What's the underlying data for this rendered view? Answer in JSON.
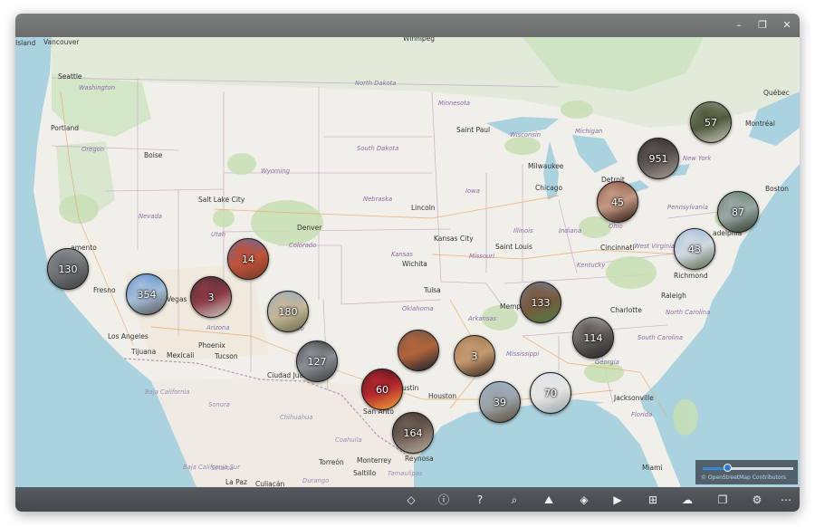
{
  "window": {
    "controls": {
      "minimize": "–",
      "maximize": "❐",
      "close": "✕"
    }
  },
  "map": {
    "labels": [
      {
        "id": "island",
        "text": "Island",
        "kind": "city"
      },
      {
        "id": "vancouver",
        "text": "Vancouver",
        "kind": "city"
      },
      {
        "id": "winnipeg",
        "text": "Winnipeg",
        "kind": "city"
      },
      {
        "id": "seattle",
        "text": "Seattle",
        "kind": "city"
      },
      {
        "id": "washington",
        "text": "Washington",
        "kind": "state"
      },
      {
        "id": "north-dakota",
        "text": "North Dakota",
        "kind": "state"
      },
      {
        "id": "quebec",
        "text": "Québec",
        "kind": "city"
      },
      {
        "id": "minnesota",
        "text": "Minnesota",
        "kind": "state"
      },
      {
        "id": "montreal",
        "text": "Montréal",
        "kind": "city"
      },
      {
        "id": "portland",
        "text": "Portland",
        "kind": "city"
      },
      {
        "id": "saint-paul",
        "text": "Saint Paul",
        "kind": "city"
      },
      {
        "id": "michigan",
        "text": "Michigan",
        "kind": "state"
      },
      {
        "id": "wisconsin",
        "text": "Wisconsin",
        "kind": "state"
      },
      {
        "id": "oregon",
        "text": "Oregon",
        "kind": "state"
      },
      {
        "id": "south-dakota",
        "text": "South Dakota",
        "kind": "state"
      },
      {
        "id": "boise",
        "text": "Boise",
        "kind": "city"
      },
      {
        "id": "new-york",
        "text": "New York",
        "kind": "state"
      },
      {
        "id": "milwaukee",
        "text": "Milwaukee",
        "kind": "city"
      },
      {
        "id": "wyoming",
        "text": "Wyoming",
        "kind": "state"
      },
      {
        "id": "detroit",
        "text": "Detroit",
        "kind": "city"
      },
      {
        "id": "chicago",
        "text": "Chicago",
        "kind": "city"
      },
      {
        "id": "boston",
        "text": "Boston",
        "kind": "city"
      },
      {
        "id": "iowa",
        "text": "Iowa",
        "kind": "state"
      },
      {
        "id": "nebraska",
        "text": "Nebraska",
        "kind": "state"
      },
      {
        "id": "salt-lake-city",
        "text": "Salt Lake City",
        "kind": "city"
      },
      {
        "id": "lincoln",
        "text": "Lincoln",
        "kind": "city"
      },
      {
        "id": "pennsylvania",
        "text": "Pennsylvania",
        "kind": "state"
      },
      {
        "id": "nevada",
        "text": "Nevada",
        "kind": "state"
      },
      {
        "id": "denver",
        "text": "Denver",
        "kind": "city"
      },
      {
        "id": "illinois",
        "text": "Illinois",
        "kind": "state"
      },
      {
        "id": "utah",
        "text": "Utah",
        "kind": "state"
      },
      {
        "id": "indiana",
        "text": "Indiana",
        "kind": "state"
      },
      {
        "id": "ohio",
        "text": "Ohio",
        "kind": "state"
      },
      {
        "id": "kansas-city",
        "text": "Kansas City",
        "kind": "city"
      },
      {
        "id": "colorado",
        "text": "Colorado",
        "kind": "state"
      },
      {
        "id": "philadelphia",
        "text": "adelphia",
        "kind": "city"
      },
      {
        "id": "saint-louis",
        "text": "Saint Louis",
        "kind": "city"
      },
      {
        "id": "cincinnati",
        "text": "Cincinnati",
        "kind": "city"
      },
      {
        "id": "west-virginia",
        "text": "West Virginia",
        "kind": "state"
      },
      {
        "id": "sacramento",
        "text": "amento",
        "kind": "city"
      },
      {
        "id": "kansas",
        "text": "Kansas",
        "kind": "state"
      },
      {
        "id": "missouri",
        "text": "Missouri",
        "kind": "state"
      },
      {
        "id": "wichita",
        "text": "Wichita",
        "kind": "city"
      },
      {
        "id": "kentucky",
        "text": "Kentucky",
        "kind": "state"
      },
      {
        "id": "richmond",
        "text": "Richmond",
        "kind": "city"
      },
      {
        "id": "tulsa",
        "text": "Tulsa",
        "kind": "city"
      },
      {
        "id": "fresno",
        "text": "Fresno",
        "kind": "city"
      },
      {
        "id": "las-vegas",
        "text": "Vegas",
        "kind": "city"
      },
      {
        "id": "raleigh",
        "text": "Raleigh",
        "kind": "city"
      },
      {
        "id": "oklahoma",
        "text": "Oklahoma",
        "kind": "state"
      },
      {
        "id": "memphis",
        "text": "Memph",
        "kind": "city"
      },
      {
        "id": "charlotte",
        "text": "Charlotte",
        "kind": "city"
      },
      {
        "id": "arkansas",
        "text": "Arkansas",
        "kind": "state"
      },
      {
        "id": "arizona",
        "text": "Arizona",
        "kind": "state"
      },
      {
        "id": "north-carolina",
        "text": "North Carolina",
        "kind": "state"
      },
      {
        "id": "new-mexico",
        "text": "xico",
        "kind": "state"
      },
      {
        "id": "los-angeles",
        "text": "Los Angeles",
        "kind": "city"
      },
      {
        "id": "phoenix",
        "text": "Phoenix",
        "kind": "city"
      },
      {
        "id": "south-carolina",
        "text": "South Carolina",
        "kind": "state"
      },
      {
        "id": "tijuana",
        "text": "Tijuana",
        "kind": "city"
      },
      {
        "id": "mexicali",
        "text": "Mexicali",
        "kind": "city"
      },
      {
        "id": "tucson",
        "text": "Tucson",
        "kind": "city"
      },
      {
        "id": "mississippi",
        "text": "Mississippi",
        "kind": "state"
      },
      {
        "id": "georgia",
        "text": "Georgia",
        "kind": "state"
      },
      {
        "id": "ciudad-juarez",
        "text": "Ciudad Jua",
        "kind": "city"
      },
      {
        "id": "baja-california",
        "text": "Baja California",
        "kind": "state-mx"
      },
      {
        "id": "austin",
        "text": "ustin",
        "kind": "city"
      },
      {
        "id": "houston",
        "text": "Houston",
        "kind": "city"
      },
      {
        "id": "jacksonville",
        "text": "Jacksonville",
        "kind": "city"
      },
      {
        "id": "san-antonio",
        "text": "San Anto",
        "kind": "city"
      },
      {
        "id": "sonora",
        "text": "Sonora",
        "kind": "state-mx"
      },
      {
        "id": "chihuahua",
        "text": "Chihuahua",
        "kind": "state-mx"
      },
      {
        "id": "florida",
        "text": "Florida",
        "kind": "state"
      },
      {
        "id": "coahuila",
        "text": "Coahuila",
        "kind": "state-mx"
      },
      {
        "id": "monterrey",
        "text": "Monterrey",
        "kind": "city"
      },
      {
        "id": "torreon",
        "text": "Torreón",
        "kind": "city"
      },
      {
        "id": "reynosa",
        "text": "Reynosa",
        "kind": "city"
      },
      {
        "id": "saltillo",
        "text": "Saltillo",
        "kind": "city"
      },
      {
        "id": "baja-california-sur",
        "text": "Baja California Sur",
        "kind": "state-mx"
      },
      {
        "id": "sinaloa",
        "text": "Sinaloa",
        "kind": "state-mx"
      },
      {
        "id": "durango",
        "text": "Durango",
        "kind": "state-mx"
      },
      {
        "id": "miami",
        "text": "Miami",
        "kind": "city"
      },
      {
        "id": "la-paz",
        "text": "La Paz",
        "kind": "city"
      },
      {
        "id": "culiacan",
        "text": "Culiacán",
        "kind": "city"
      },
      {
        "id": "tamaulipas",
        "text": "Tamaulipas",
        "kind": "state-mx"
      }
    ],
    "clusters": [
      {
        "id": "quebec",
        "count": "57",
        "colors": [
          "#b8b0a0",
          "#4e5a3d",
          "#c7c2b6"
        ]
      },
      {
        "id": "ontario",
        "count": "951",
        "colors": [
          "#1b1a1c",
          "#5b5350",
          "#a49a92"
        ]
      },
      {
        "id": "boston-area",
        "count": "87",
        "colors": [
          "#4d6b49",
          "#9aa7a6",
          "#2c3b29"
        ]
      },
      {
        "id": "ohio",
        "count": "45",
        "colors": [
          "#6b2a1e",
          "#c39a83",
          "#2b1712"
        ]
      },
      {
        "id": "virginia",
        "count": "43",
        "colors": [
          "#7aa7d6",
          "#d1d9e0",
          "#5c6b4e"
        ]
      },
      {
        "id": "california-north",
        "count": "130",
        "colors": [
          "#a9acae",
          "#6f7274",
          "#3e4042"
        ]
      },
      {
        "id": "utah",
        "count": "14",
        "colors": [
          "#2f77d1",
          "#c0533a",
          "#7a3b26"
        ]
      },
      {
        "id": "california-south",
        "count": "354",
        "colors": [
          "#2f70c4",
          "#a4bed8",
          "#585a58"
        ]
      },
      {
        "id": "nevada",
        "count": "3",
        "colors": [
          "#2b2b2f",
          "#8a3a44",
          "#d0c7c1"
        ]
      },
      {
        "id": "new-mexico",
        "count": "180",
        "colors": [
          "#6ea6d4",
          "#c7b79a",
          "#6b6a4b"
        ]
      },
      {
        "id": "tennessee",
        "count": "133",
        "colors": [
          "#6e8fb8",
          "#7a5a3f",
          "#4a7a3c"
        ]
      },
      {
        "id": "georgia",
        "count": "114",
        "colors": [
          "#cfd2d2",
          "#5e5a55",
          "#2a2a2a"
        ]
      },
      {
        "id": "el-paso",
        "count": "127",
        "colors": [
          "#0f0f10",
          "#8b9094",
          "#3b3e41"
        ]
      },
      {
        "id": "oklahoma-south",
        "count": "",
        "colors": [
          "#3f4a58",
          "#b3643a",
          "#182230"
        ]
      },
      {
        "id": "louisiana",
        "count": "3",
        "colors": [
          "#8a6244",
          "#c59a6f",
          "#3d2a1e"
        ]
      },
      {
        "id": "texas-central",
        "count": "60",
        "colors": [
          "#1a0f10",
          "#b3262f",
          "#f0a330"
        ]
      },
      {
        "id": "gulf-coast",
        "count": "39",
        "colors": [
          "#9cc3e6",
          "#9aa2a6",
          "#5b4e3f"
        ]
      },
      {
        "id": "florida-panhandle",
        "count": "70",
        "colors": [
          "#cfe2f4",
          "#e6e6e3",
          "#9aa5a8"
        ]
      },
      {
        "id": "texas-south",
        "count": "164",
        "colors": [
          "#241d1b",
          "#6f5f55",
          "#b8a79a"
        ]
      }
    ],
    "attribution": "© OpenStreetMap Contributors"
  },
  "zoom": {
    "level_fraction": 0.27
  },
  "toolbar": {
    "items": [
      {
        "id": "premium",
        "icon": "diamond-icon",
        "glyph": "◇"
      },
      {
        "id": "info",
        "icon": "info-icon",
        "glyph": "ⓘ"
      },
      {
        "id": "help",
        "icon": "help-icon",
        "glyph": "?"
      },
      {
        "id": "search",
        "icon": "search-icon",
        "glyph": "⌕"
      },
      {
        "id": "map-style",
        "icon": "map-style-icon",
        "glyph": "⛰"
      },
      {
        "id": "layers",
        "icon": "layers-icon",
        "glyph": "◈"
      },
      {
        "id": "slideshow",
        "icon": "play-icon",
        "glyph": "▶"
      },
      {
        "id": "grid",
        "icon": "grid-icon",
        "glyph": "⊞"
      },
      {
        "id": "cloud",
        "icon": "cloud-icon",
        "glyph": "☁"
      },
      {
        "id": "folders",
        "icon": "folders-icon",
        "glyph": "❐"
      },
      {
        "id": "settings",
        "icon": "gear-icon",
        "glyph": "⚙"
      },
      {
        "id": "more",
        "icon": "more-icon",
        "glyph": "⋯"
      }
    ]
  }
}
